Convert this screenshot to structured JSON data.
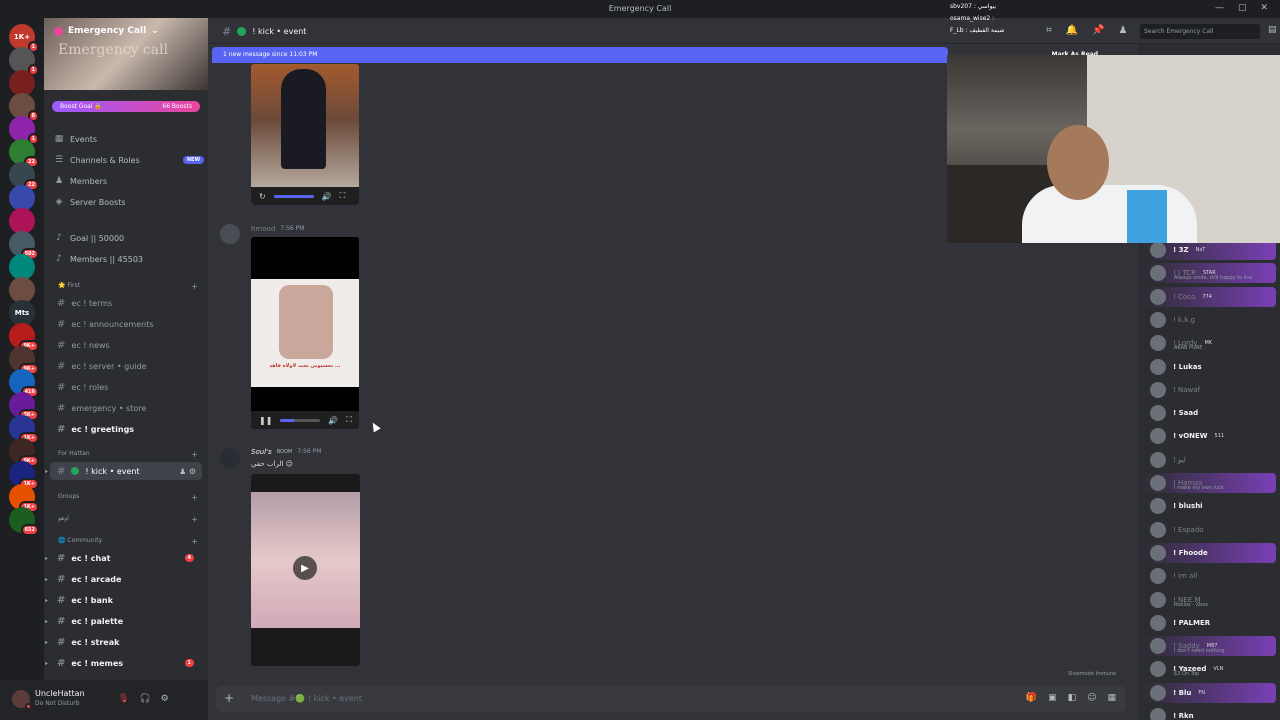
{
  "window": {
    "title": "Emergency Call"
  },
  "servers": [
    {
      "label": "1K+",
      "badge": "1",
      "color": "#c0392b"
    },
    {
      "label": "",
      "badge": "1",
      "color": "#555"
    },
    {
      "label": "",
      "badge": "",
      "color": "#7a1f1f"
    },
    {
      "label": "",
      "badge": "8",
      "color": "#6d4c41"
    },
    {
      "label": "",
      "badge": "1",
      "color": "#8e24aa"
    },
    {
      "label": "",
      "badge": "22",
      "color": "#2e7d32"
    },
    {
      "label": "",
      "badge": "22",
      "color": "#37474f"
    },
    {
      "label": "",
      "badge": "",
      "color": "#3949ab"
    },
    {
      "label": "",
      "badge": "",
      "color": "#ad1457"
    },
    {
      "label": "",
      "badge": "502",
      "color": "#455a64"
    },
    {
      "label": "",
      "badge": "",
      "color": "#00897b"
    },
    {
      "label": "",
      "badge": "",
      "color": "#6d4c41"
    },
    {
      "label": "Mts",
      "badge": "",
      "color": "#263238"
    },
    {
      "label": "",
      "badge": "9K+",
      "color": "#b71c1c"
    },
    {
      "label": "",
      "badge": "9K+",
      "color": "#4e342e"
    },
    {
      "label": "",
      "badge": "416",
      "color": "#1565c0"
    },
    {
      "label": "",
      "badge": "3K+",
      "color": "#6a1b9a"
    },
    {
      "label": "",
      "badge": "1K+",
      "color": "#283593"
    },
    {
      "label": "",
      "badge": "9K+",
      "color": "#3e2723"
    },
    {
      "label": "",
      "badge": "1K+",
      "color": "#1a237e"
    },
    {
      "label": "",
      "badge": "1K+",
      "color": "#e65100"
    },
    {
      "label": "",
      "badge": "652",
      "color": "#1b5e20"
    }
  ],
  "guild": {
    "name": "Emergency Call",
    "watermark": "Emergency call",
    "boost_goal": "Boost Goal 🔒",
    "boosts": "66 Boosts"
  },
  "nav": [
    {
      "label": "Events",
      "icon": "calendar-icon",
      "glyph": "▦",
      "new": false
    },
    {
      "label": "Channels & Roles",
      "icon": "channels-icon",
      "glyph": "☰",
      "new": true
    },
    {
      "label": "Members",
      "icon": "members-icon",
      "glyph": "♟",
      "new": false
    },
    {
      "label": "Server Boosts",
      "icon": "boost-icon",
      "glyph": "◈",
      "new": false
    }
  ],
  "new_label": "NEW",
  "goals": [
    {
      "label": "Goal || 50000",
      "glyph": "♪"
    },
    {
      "label": "Members || 45503",
      "glyph": "♪"
    }
  ],
  "categories": {
    "first": "🌟 First",
    "for_hattan": "For Hattan",
    "groups": "Groups",
    "aoho": "اوهو",
    "community": "🌐 Community"
  },
  "channels_first": [
    {
      "label": "ec ! terms",
      "bold": false
    },
    {
      "label": "ec ! announcements",
      "bold": false
    },
    {
      "label": "ec ! news",
      "bold": false
    },
    {
      "label": "ec ! server • guide",
      "bold": false
    },
    {
      "label": "ec ! roles",
      "bold": false
    },
    {
      "label": "emergency • store",
      "bold": false
    },
    {
      "label": "ec ! greetings",
      "bold": true
    }
  ],
  "selected_channel": "! kick • event",
  "channels_community": [
    {
      "label": "ec ! chat",
      "count": "4"
    },
    {
      "label": "ec ! arcade",
      "count": ""
    },
    {
      "label": "ec ! bank",
      "count": ""
    },
    {
      "label": "ec ! palette",
      "count": ""
    },
    {
      "label": "ec ! streak",
      "count": ""
    },
    {
      "label": "ec ! memes",
      "count": "1"
    }
  ],
  "user": {
    "name": "UncleHattan",
    "status": "Do Not Disturb"
  },
  "header": {
    "channel": "! kick • event",
    "search_placeholder": "Search Emergency Call"
  },
  "new_messages": {
    "text": "1 new message since 11:03 PM",
    "mark": "Mark As Read"
  },
  "messages": [
    {
      "author": "hmood",
      "time": "7:56 PM",
      "text": "",
      "video_caption": "تحسبوني تحت لاولاه فاهد ..."
    },
    {
      "author": "Soul's",
      "time": "7:56 PM",
      "role": "BOOM",
      "text": "الراب حقي 😉"
    }
  ],
  "slowmode": "Slowmode Immune",
  "composer": {
    "placeholder": "Message #🟢 ! kick • event"
  },
  "members": [
    {
      "name": "! 3Z",
      "tag": "NxT",
      "sub": "",
      "dim": false,
      "glow": true
    },
    {
      "name": "! I TCR",
      "tag": "STAR",
      "sub": "Always smile, still happy to live",
      "dim": true,
      "glow": true
    },
    {
      "name": "! Coco",
      "tag": "774",
      "sub": "",
      "dim": true,
      "glow": true
    },
    {
      "name": "! k.k.g",
      "tag": "",
      "sub": "",
      "dim": true,
      "glow": false
    },
    {
      "name": "! Lordy",
      "tag": "MK",
      "sub": "AKAB PURE",
      "dim": true,
      "glow": false
    },
    {
      "name": "! Lukas",
      "tag": "",
      "sub": "",
      "dim": false,
      "glow": false
    },
    {
      "name": "! Nawaf",
      "tag": "",
      "sub": "",
      "dim": true,
      "glow": false
    },
    {
      "name": "! Saad",
      "tag": "",
      "sub": "",
      "dim": false,
      "glow": false
    },
    {
      "name": "! vONEW",
      "tag": "511",
      "sub": "",
      "dim": false,
      "glow": false
    },
    {
      "name": "! ليو",
      "tag": "",
      "sub": "",
      "dim": true,
      "glow": false
    },
    {
      "name": "! Hamza",
      "tag": "",
      "sub": "I make my own luck",
      "dim": true,
      "glow": true
    },
    {
      "name": "! blushi",
      "tag": "",
      "sub": "",
      "dim": false,
      "glow": false
    },
    {
      "name": "! Espado",
      "tag": "",
      "sub": "",
      "dim": true,
      "glow": false
    },
    {
      "name": "! Fhoode",
      "tag": "",
      "sub": "",
      "dim": false,
      "glow": true
    },
    {
      "name": "! im all",
      "tag": "",
      "sub": "",
      "dim": true,
      "glow": false
    },
    {
      "name": "! NEE.M",
      "tag": "",
      "sub": "Roblox - Xbox",
      "dim": true,
      "glow": false
    },
    {
      "name": "! PALMER",
      "tag": "",
      "sub": "",
      "dim": false,
      "glow": false
    },
    {
      "name": "! Saddy",
      "tag": "M87",
      "sub": "I don't need nothing",
      "dim": true,
      "glow": true
    },
    {
      "name": "! Yazeed",
      "tag": "VLN",
      "sub": "$3 On Top",
      "dim": false,
      "glow": false
    },
    {
      "name": "! Blu",
      "tag": "FN",
      "sub": "",
      "dim": false,
      "glow": true
    },
    {
      "name": "! Rkn",
      "tag": "",
      "sub": "",
      "dim": false,
      "glow": false
    }
  ],
  "stream_chat": [
    {
      "text": "sbv207 : بيواسي"
    },
    {
      "text": "osama_wise2 :"
    },
    {
      "text": "F_Lb : شيمة القطيف"
    }
  ]
}
